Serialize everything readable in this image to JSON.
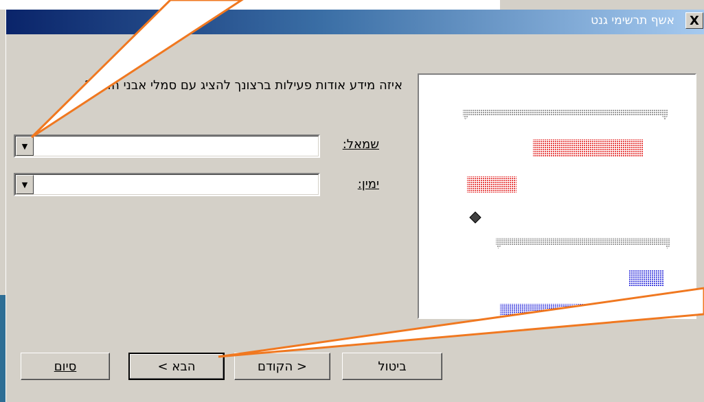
{
  "window": {
    "title": "אשף תרשימי גנט",
    "close_glyph": "X"
  },
  "question": "איזה מידע אודות פעילות ברצונך להציג עם סמלי אבני הדרך?",
  "fields": {
    "left_label": "שמאל:",
    "left_value": "",
    "right_label": "ימין:",
    "right_value": ""
  },
  "buttons": {
    "cancel": "ביטול",
    "back": "< הקודם",
    "next": "הבא >",
    "finish": "סיום"
  },
  "icons": {
    "dropdown": "chevron-down-icon",
    "milestone": "diamond-icon"
  },
  "colors": {
    "title_start": "#0a246a",
    "title_end": "#a6caf0",
    "callout_outline": "#f07820",
    "bar_gray": "#9e9e9e",
    "bar_red": "#e84a4a",
    "bar_blue": "#4a4ae0"
  }
}
